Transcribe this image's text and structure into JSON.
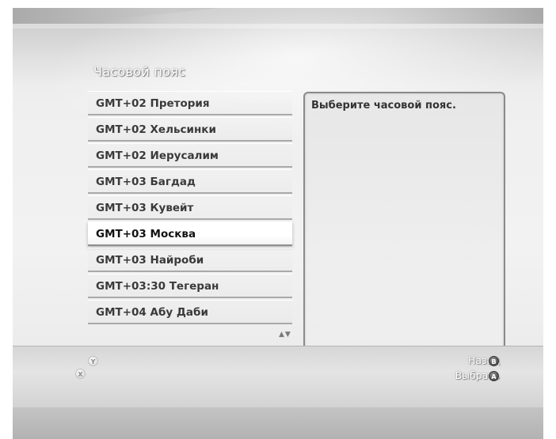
{
  "screen": {
    "title": "Часовой пояс"
  },
  "timezones": [
    {
      "label": "GMT+02 Претория",
      "selected": false
    },
    {
      "label": "GMT+02 Хельсинки",
      "selected": false
    },
    {
      "label": "GMT+02 Иерусалим",
      "selected": false
    },
    {
      "label": "GMT+03 Багдад",
      "selected": false
    },
    {
      "label": "GMT+03 Кувейт",
      "selected": false
    },
    {
      "label": "GMT+03 Москва",
      "selected": true
    },
    {
      "label": "GMT+03 Найроби",
      "selected": false
    },
    {
      "label": "GMT+03:30 Тегеран",
      "selected": false
    },
    {
      "label": "GMT+04 Абу Даби",
      "selected": false
    }
  ],
  "scroll_indicator": "▲▼",
  "help_panel": {
    "text": "Выберите часовой пояс."
  },
  "controller_buttons": {
    "y": "Y",
    "x": "X",
    "b": "B",
    "a": "A"
  },
  "actions": {
    "back_label": "Назад",
    "select_label": "Выбрать"
  }
}
